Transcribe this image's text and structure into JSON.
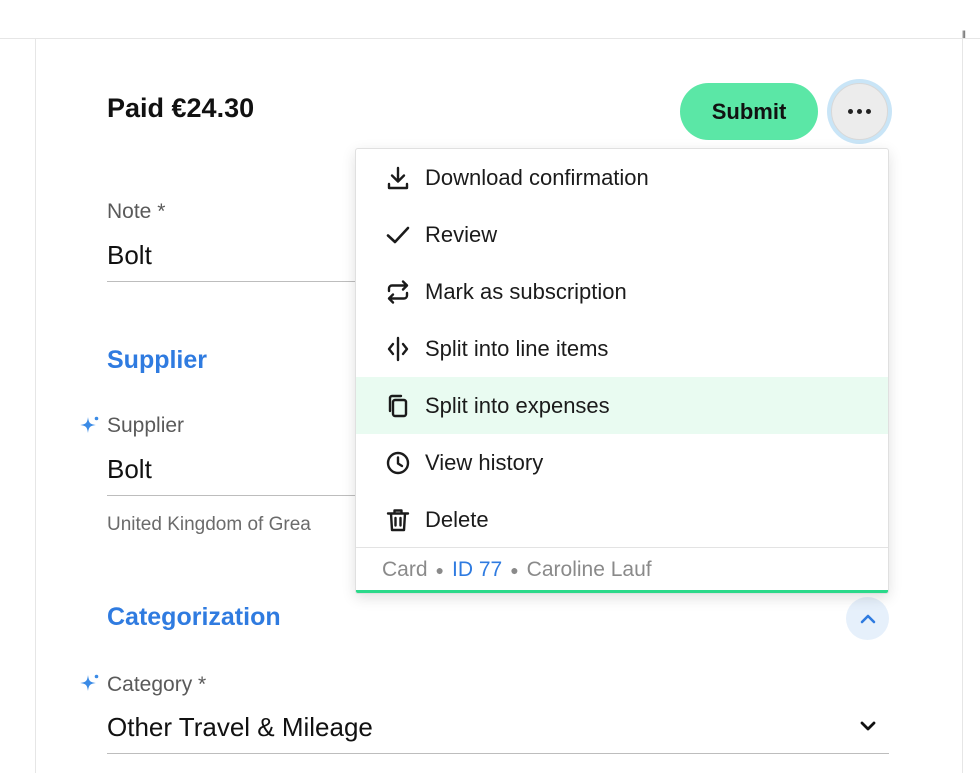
{
  "header": {
    "paid_label": "Paid €24.30",
    "corner_mark": "‖"
  },
  "actions": {
    "submit_label": "Submit"
  },
  "form": {
    "note": {
      "label": "Note *",
      "value": "Bolt"
    },
    "supplier_section": "Supplier",
    "supplier": {
      "label": "Supplier",
      "value": "Bolt",
      "hint": "United Kingdom of Grea"
    },
    "categorization_section": "Categorization",
    "category": {
      "label": "Category *",
      "value": "Other Travel & Mileage"
    }
  },
  "menu": {
    "items": [
      {
        "label": "Download confirmation",
        "icon": "download-icon"
      },
      {
        "label": "Review",
        "icon": "check-icon"
      },
      {
        "label": "Mark as subscription",
        "icon": "repeat-icon"
      },
      {
        "label": "Split into line items",
        "icon": "split-icon"
      },
      {
        "label": "Split into expenses",
        "icon": "copy-icon"
      },
      {
        "label": "View history",
        "icon": "clock-icon"
      },
      {
        "label": "Delete",
        "icon": "trash-icon"
      }
    ],
    "footer": {
      "card": "Card",
      "id": "ID 77",
      "user": "Caroline Lauf"
    }
  },
  "colors": {
    "accent": "#2f7be0",
    "submit_bg": "#5be7a6",
    "highlight": "#e9fbf1",
    "bar": "#2bd98a"
  }
}
